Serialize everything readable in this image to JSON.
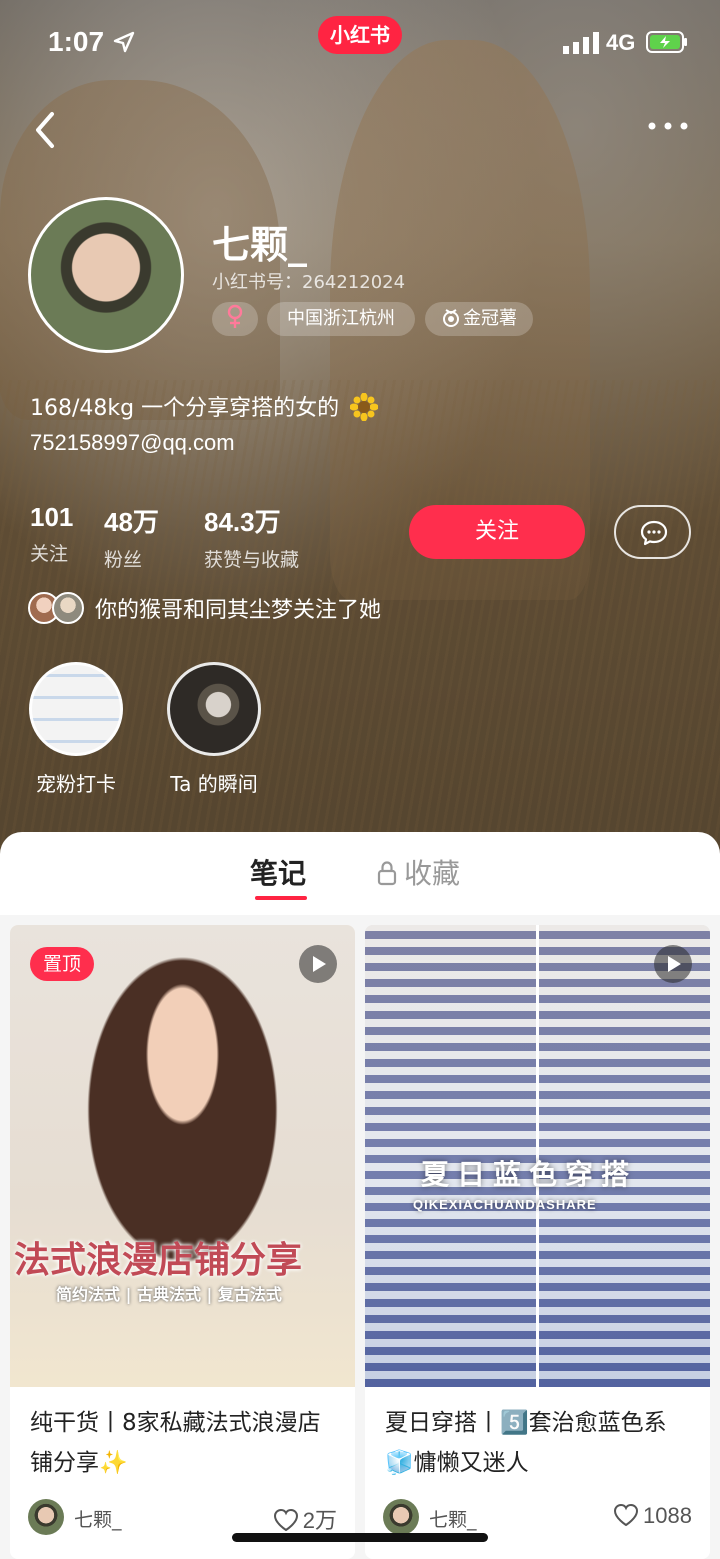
{
  "status_bar": {
    "time": "1:07",
    "network": "4G",
    "app_badge": "小红书"
  },
  "profile": {
    "name": "七颗_",
    "red_id": "小红书号：264212024",
    "tags": {
      "location": "中国浙江杭州",
      "award": "金冠薯"
    },
    "bio_line1": "168/48kg 一个分享穿搭的女的",
    "bio_line2": "752158997@qq.com",
    "stats": [
      {
        "num": "101",
        "label": "关注"
      },
      {
        "num": "48万",
        "label": "粉丝"
      },
      {
        "num": "84.3万",
        "label": "获赞与收藏"
      }
    ],
    "follow_label": "关注",
    "mutual_text": "你的猴哥和同其尘梦关注了她"
  },
  "highlights": [
    {
      "label": "宠粉打卡"
    },
    {
      "label": "Ta 的瞬间"
    }
  ],
  "tabs": [
    {
      "label": "笔记",
      "active": true
    },
    {
      "label": "收藏",
      "active": false,
      "locked": true
    }
  ],
  "notes": [
    {
      "pinned_label": "置顶",
      "overlay_title": "法式浪漫店铺分享",
      "overlay_sub": "简约法式 | 古典法式 | 复古法式",
      "title": "纯干货丨8家私藏法式浪漫店铺分享✨",
      "author": "七颗_",
      "likes": "2万",
      "video": true
    },
    {
      "overlay_title": "夏日蓝色穿搭",
      "overlay_sub": "QIKEXIACHUANDASHARE",
      "title": "夏日穿搭丨5️⃣套治愈蓝色系🧊慵懒又迷人",
      "author": "七颗_",
      "likes": "1088",
      "video": true
    }
  ],
  "colors": {
    "accent": "#ff2442",
    "follow_button": "#ff2e4d"
  }
}
